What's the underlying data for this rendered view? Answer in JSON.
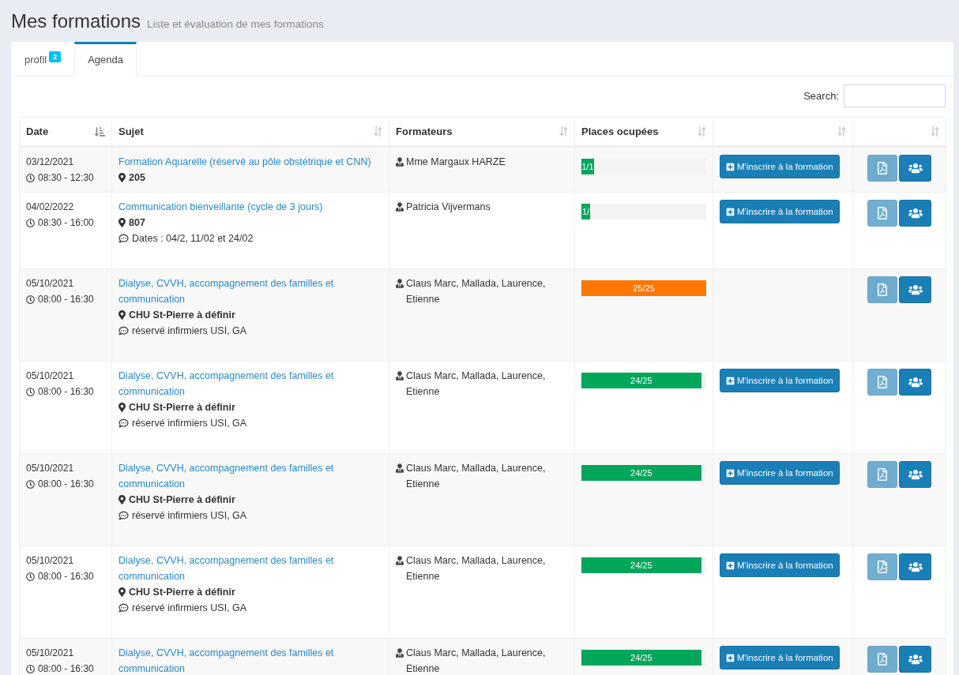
{
  "header": {
    "title": "Mes formations",
    "subtitle": "Liste et évaluation de mes formations"
  },
  "tabs": [
    {
      "label": "profil",
      "badge": "2",
      "selected": false
    },
    {
      "label": "Agenda",
      "selected": true
    }
  ],
  "search": {
    "label": "Search:"
  },
  "table": {
    "columns": [
      {
        "label": "Date",
        "sorted": true
      },
      {
        "label": "Sujet",
        "sorted": false
      },
      {
        "label": "Formateurs",
        "sorted": false
      },
      {
        "label": "Places ocupées",
        "sorted": false
      },
      {
        "sorted": false
      },
      {
        "sorted": false
      }
    ],
    "rows": [
      {
        "date": "03/12/2021",
        "time": "08:30 - 12:30",
        "subject": "Formation Aquarelle (réservé au pôle obstétrique et CNN)",
        "location": "205",
        "trainers": "Mme Margaux HARZE",
        "places": {
          "reading": "1/1",
          "level": 0.1,
          "color": "#00a65a"
        },
        "register_button": "M'inscrire à la formation",
        "pdf_disabled": true
      },
      {
        "date": "04/02/2022",
        "time": "08:30 - 16:00",
        "subject": "Communication bienveillante (cycle de 3 jours)",
        "location": "807",
        "comment": "Dates : 04/2, 11/02 et 24/02",
        "trainers": "Patricia Vijvermans",
        "places": {
          "reading": "1/",
          "level": 0.07,
          "color": "#00a65a"
        },
        "register_button": "M'inscrire à la formation",
        "pdf_disabled": true
      },
      {
        "date": "05/10/2021",
        "time": "08:00 - 16:30",
        "subject": "Dialyse, CVVH, accompagnement des familles et communication",
        "location": "CHU St-Pierre à définir",
        "comment": "réservé infirmiers USI, GA",
        "trainers": "Claus Marc, Mallada, Laurence, Etienne",
        "places": {
          "reading": "25/25",
          "level": 1,
          "color": "#ff7701"
        },
        "pdf_disabled": true
      },
      {
        "date": "05/10/2021",
        "time": "08:00 - 16:30",
        "subject": "Dialyse, CVVH, accompagnement des familles et communication",
        "location": "CHU St-Pierre à définir",
        "comment": "réservé infirmiers USI, GA",
        "trainers": "Claus Marc, Mallada, Laurence, Etienne",
        "places": {
          "reading": "24/25",
          "level": 0.96,
          "color": "#00a65a"
        },
        "register_button": "M'inscrire à la formation",
        "pdf_disabled": true
      },
      {
        "date": "05/10/2021",
        "time": "08:00 - 16:30",
        "subject": "Dialyse, CVVH, accompagnement des familles et communication",
        "location": "CHU St-Pierre à définir",
        "comment": "réservé infirmiers USI, GA",
        "trainers": "Claus Marc, Mallada, Laurence, Etienne",
        "places": {
          "reading": "24/25",
          "level": 0.96,
          "color": "#00a65a"
        },
        "register_button": "M'inscrire à la formation",
        "pdf_disabled": true
      },
      {
        "date": "05/10/2021",
        "time": "08:00 - 16:30",
        "subject": "Dialyse, CVVH, accompagnement des familles et communication",
        "location": "CHU St-Pierre à définir",
        "comment": "réservé infirmiers USI, GA",
        "trainers": "Claus Marc, Mallada, Laurence, Etienne",
        "places": {
          "reading": "24/25",
          "level": 0.96,
          "color": "#00a65a"
        },
        "register_button": "M'inscrire à la formation",
        "pdf_disabled": true
      },
      {
        "date": "05/10/2021",
        "time": "08:00 - 16:30",
        "subject": "Dialyse, CVVH, accompagnement des familles et communication",
        "trainers": "Claus Marc, Mallada, Laurence, Etienne",
        "places": {
          "reading": "24/25",
          "level": 0.96,
          "color": "#00a65a"
        },
        "register_button": "M'inscrire à la formation",
        "pdf_disabled": true
      }
    ]
  }
}
